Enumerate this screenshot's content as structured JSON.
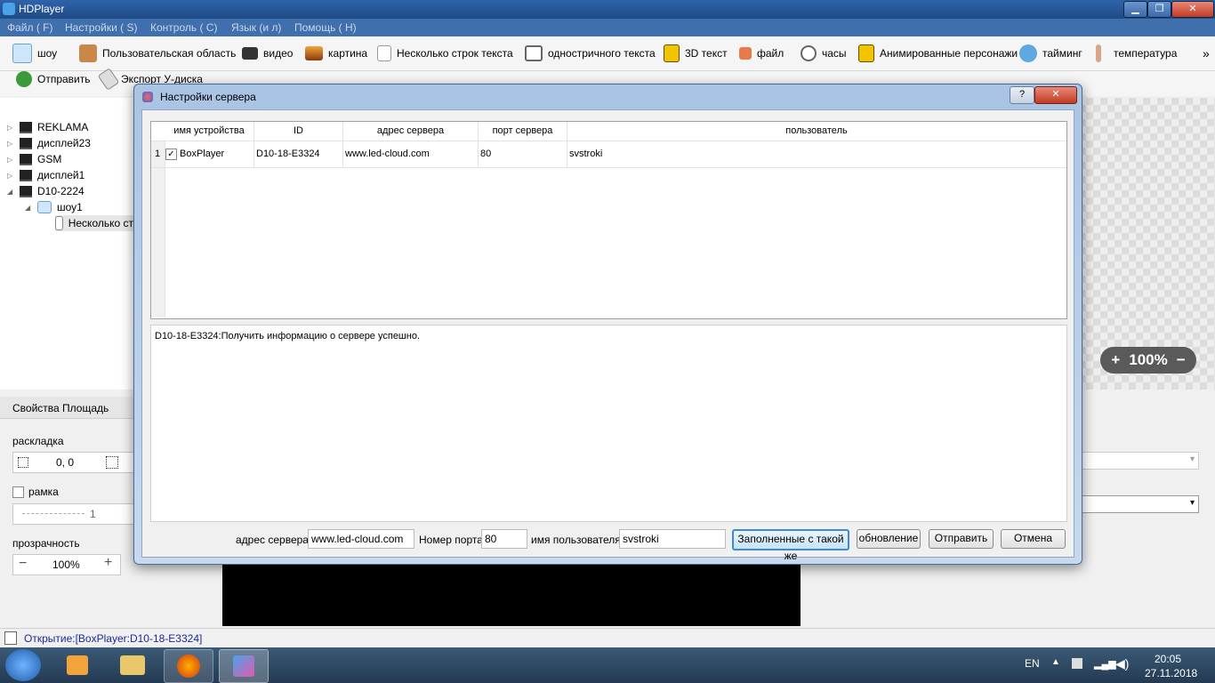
{
  "app": {
    "title": "HDPlayer",
    "menu": [
      "Файл ( F)",
      "Настройки ( S)",
      "Контроль ( C)",
      "Язык (и л)",
      "Помощь ( H)"
    ]
  },
  "toolbar": {
    "items": [
      "шоу",
      "Пользовательская область",
      "видео",
      "картина",
      "Несколько строк текста",
      "одностричного текста",
      "3D текст",
      "файл",
      "часы",
      "Анимированные персонажи",
      "тайминг",
      "температура"
    ],
    "more": "»"
  },
  "toolbar2": {
    "send": "Отправить",
    "export": "Экспорт У-диска"
  },
  "tree": {
    "items": [
      "REKLAMA",
      "дисплей23",
      "GSM",
      "дисплей1",
      "D10-2224",
      "шоу1",
      "Несколько ст"
    ]
  },
  "props": {
    "tab": "Свойства Площадь",
    "layout_label": "раскладка",
    "layout_value": "0, 0",
    "frame_label": "рамка",
    "frame_value": "1",
    "opacity_label": "прозрачность",
    "opacity_value": "100%"
  },
  "canvas": {
    "zoom": "100%"
  },
  "status": {
    "text": "Открытие:[BoxPlayer:D10-18-E3324]"
  },
  "dialog": {
    "title": "Настройки сервера",
    "help": "?",
    "close": "✕",
    "columns": [
      "имя устройства",
      "ID",
      "адрес сервера",
      "порт сервера",
      "пользователь"
    ],
    "rows": [
      {
        "num": "1",
        "checked": true,
        "device": "BoxPlayer",
        "id": "D10-18-E3324",
        "server": "www.led-cloud.com",
        "port": "80",
        "user": "svstroki"
      }
    ],
    "log": "D10-18-E3324:Получить информацию о сервере успешно.",
    "form": {
      "server_label": "адрес сервера",
      "server_value": "www.led-cloud.com",
      "port_label": "Номер порта",
      "port_value": "80",
      "user_label": "имя пользователя",
      "user_value": "svstroki"
    },
    "buttons": {
      "fill": "Заполненные с такой же",
      "refresh": "обновление",
      "send": "Отправить",
      "cancel": "Отмена"
    }
  },
  "taskbar": {
    "lang": "EN",
    "time": "20:05",
    "date": "27.11.2018"
  }
}
